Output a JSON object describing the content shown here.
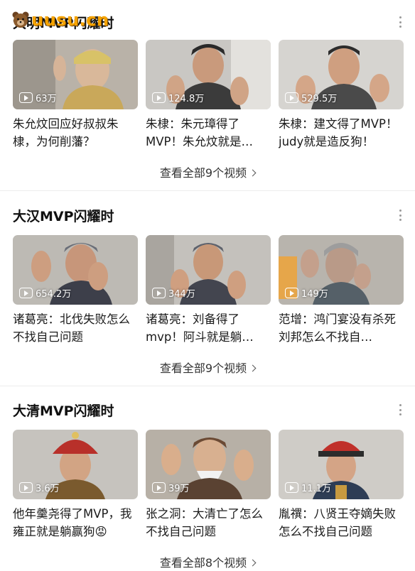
{
  "watermark": {
    "text": "uusu.cn",
    "icon": "bear-logo-icon"
  },
  "sections": [
    {
      "title": "大明MVP闪耀时",
      "view_all": "查看全部9个视频",
      "videos": [
        {
          "views": "63万",
          "caption": "朱允炆回应好叔叔朱棣，为何削藩？"
        },
        {
          "views": "124.8万",
          "caption": "朱棣：朱元璋得了MVP！朱允炆就是…"
        },
        {
          "views": "529.5万",
          "caption": "朱棣：建文得了MVP！judy就是造反狗！"
        }
      ]
    },
    {
      "title": "大汉MVP闪耀时",
      "view_all": "查看全部9个视频",
      "videos": [
        {
          "views": "654.2万",
          "caption": "诸葛亮：北伐失败怎么不找自己问题"
        },
        {
          "views": "344万",
          "caption": "诸葛亮：刘备得了mvp！阿斗就是躺…"
        },
        {
          "views": "149万",
          "caption": "范增：鸿门宴没有杀死刘邦怎么不找自…"
        }
      ]
    },
    {
      "title": "大清MVP闪耀时",
      "view_all": "查看全部8个视频",
      "videos": [
        {
          "views": "3.6万",
          "caption": "他年羹尧得了MVP，我雍正就是躺赢狗😡"
        },
        {
          "views": "39万",
          "caption": "张之洞：大清亡了怎么不找自己问题"
        },
        {
          "views": "11.1万",
          "caption": "胤禩：八贤王夺嫡失败怎么不找自己问题"
        }
      ]
    }
  ]
}
